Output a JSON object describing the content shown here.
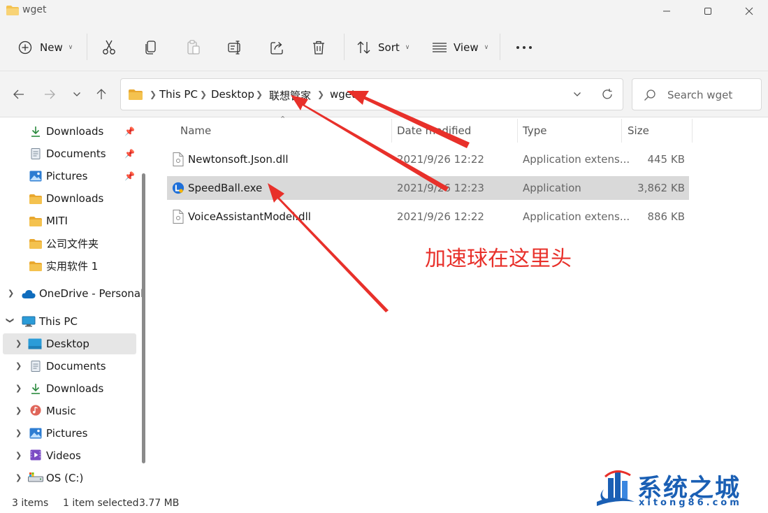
{
  "window": {
    "title": "wget"
  },
  "toolbar": {
    "new_label": "New",
    "sort_label": "Sort",
    "view_label": "View"
  },
  "address": {
    "crumbs": [
      "This PC",
      "Desktop",
      "联想管家",
      "wget"
    ],
    "search_placeholder": "Search wget"
  },
  "sidebar": {
    "quick_access": [
      {
        "label": "Downloads",
        "icon": "download-icon",
        "pinned": true
      },
      {
        "label": "Documents",
        "icon": "document-icon",
        "pinned": true
      },
      {
        "label": "Pictures",
        "icon": "pictures-icon",
        "pinned": true
      },
      {
        "label": "Downloads",
        "icon": "folder-icon",
        "pinned": false
      },
      {
        "label": "MITI",
        "icon": "folder-icon",
        "pinned": false
      },
      {
        "label": "公司文件夹",
        "icon": "folder-icon",
        "pinned": false
      },
      {
        "label": "实用软件 1",
        "icon": "folder-icon",
        "pinned": false
      }
    ],
    "onedrive": "OneDrive - Personal",
    "this_pc": "This PC",
    "pc_items": [
      {
        "label": "Desktop",
        "icon": "desktop-icon",
        "selected": true
      },
      {
        "label": "Documents",
        "icon": "document-icon",
        "selected": false
      },
      {
        "label": "Downloads",
        "icon": "download-icon",
        "selected": false
      },
      {
        "label": "Music",
        "icon": "music-icon",
        "selected": false
      },
      {
        "label": "Pictures",
        "icon": "pictures-icon",
        "selected": false
      },
      {
        "label": "Videos",
        "icon": "videos-icon",
        "selected": false
      },
      {
        "label": "OS (C:)",
        "icon": "drive-icon",
        "selected": false
      }
    ]
  },
  "columns": {
    "name": "Name",
    "date": "Date modified",
    "type": "Type",
    "size": "Size"
  },
  "files": [
    {
      "name": "Newtonsoft.Json.dll",
      "date": "2021/9/26 12:22",
      "type": "Application extens...",
      "size": "445 KB",
      "selected": false
    },
    {
      "name": "SpeedBall.exe",
      "date": "2021/9/26 12:23",
      "type": "Application",
      "size": "3,862 KB",
      "selected": true
    },
    {
      "name": "VoiceAssistantModel.dll",
      "date": "2021/9/26 12:22",
      "type": "Application extens...",
      "size": "886 KB",
      "selected": false
    }
  ],
  "annotation_text": "加速球在这里头",
  "status": {
    "items": "3 items",
    "selected": "1 item selected",
    "size": "3.77 MB"
  },
  "watermark": {
    "text": "系统之城",
    "url": "xitong86.com"
  },
  "colors": {
    "folder": "#f4c24f",
    "accent": "#0067c0",
    "annotation": "#e8302a",
    "selection": "#d9d9d9"
  }
}
